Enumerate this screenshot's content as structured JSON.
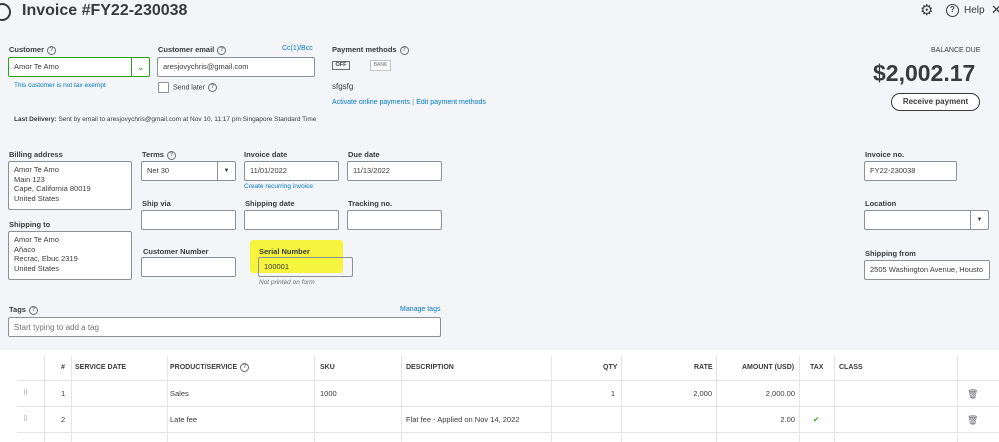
{
  "header": {
    "title": "Invoice #FY22-230038",
    "help_label": "Help"
  },
  "customer": {
    "label": "Customer",
    "value": "Amor Te Amo",
    "tax_note": "This customer is not tax exempt"
  },
  "email": {
    "label": "Customer email",
    "value": "aresjovychris@gmail.com",
    "cc_bcc": "Cc(1)/Bcc",
    "send_later": "Send later"
  },
  "payment": {
    "label": "Payment methods",
    "toggle": "OFF",
    "bank": "BANK",
    "note": "sfgsfg",
    "activate_link": "Activate online payments",
    "separator": "|",
    "edit_link": "Edit payment methods"
  },
  "balance": {
    "label": "BALANCE DUE",
    "amount": "$2,002.17",
    "receive_button": "Receive payment"
  },
  "last_delivery": {
    "label": "Last Delivery:",
    "text": "Sent by email to aresjovychris@gmail.com at Nov 10, 11:17 pm Singapore Standard Time"
  },
  "billing": {
    "label": "Billing address",
    "lines": [
      "Amor Te Amo",
      "Main 123",
      "Cape, California  80019",
      "United States"
    ]
  },
  "shipping": {
    "label": "Shipping to",
    "lines": [
      "Amor Te Amo",
      "Añaco",
      "Recrac, Ebuc  2319",
      "United States"
    ]
  },
  "terms": {
    "label": "Terms",
    "value": "Net 30"
  },
  "invoice_date": {
    "label": "Invoice date",
    "value": "11/01/2022",
    "recurring_link": "Create recurring invoice"
  },
  "due_date": {
    "label": "Due date",
    "value": "11/13/2022"
  },
  "invoice_no": {
    "label": "Invoice no.",
    "value": "FY22-230038"
  },
  "ship_via": {
    "label": "Ship via",
    "value": ""
  },
  "shipping_date": {
    "label": "Shipping date",
    "value": ""
  },
  "tracking": {
    "label": "Tracking no.",
    "value": ""
  },
  "location": {
    "label": "Location",
    "value": ""
  },
  "customer_number": {
    "label": "Customer Number",
    "value": ""
  },
  "serial_number": {
    "label": "Serial Number",
    "value": "100001",
    "note": "Not printed on form"
  },
  "shipping_from": {
    "label": "Shipping from",
    "value": "2505 Washington Avenue, Housto"
  },
  "tags": {
    "label": "Tags",
    "manage_link": "Manage tags",
    "placeholder": "Start typing to add a tag"
  },
  "table": {
    "headers": {
      "num": "#",
      "service_date": "SERVICE DATE",
      "product": "PRODUCT/SERVICE",
      "sku": "SKU",
      "description": "DESCRIPTION",
      "qty": "QTY",
      "rate": "RATE",
      "amount": "AMOUNT (USD)",
      "tax": "TAX",
      "class": "CLASS"
    },
    "rows": [
      {
        "num": "1",
        "service_date": "",
        "product": "Sales",
        "sku": "1000",
        "description": "",
        "qty": "1",
        "rate": "2,000",
        "amount": "2,000.00",
        "tax": ""
      },
      {
        "num": "2",
        "service_date": "",
        "product": "Late fee",
        "sku": "",
        "description": "Flat fee - Applied on Nov 14, 2022",
        "qty": "",
        "rate": "",
        "amount": "2.00",
        "tax": "✔"
      }
    ]
  },
  "colors": {
    "accent": "#2ca01c",
    "link": "#0077c5",
    "highlight": "#f5f51e"
  }
}
